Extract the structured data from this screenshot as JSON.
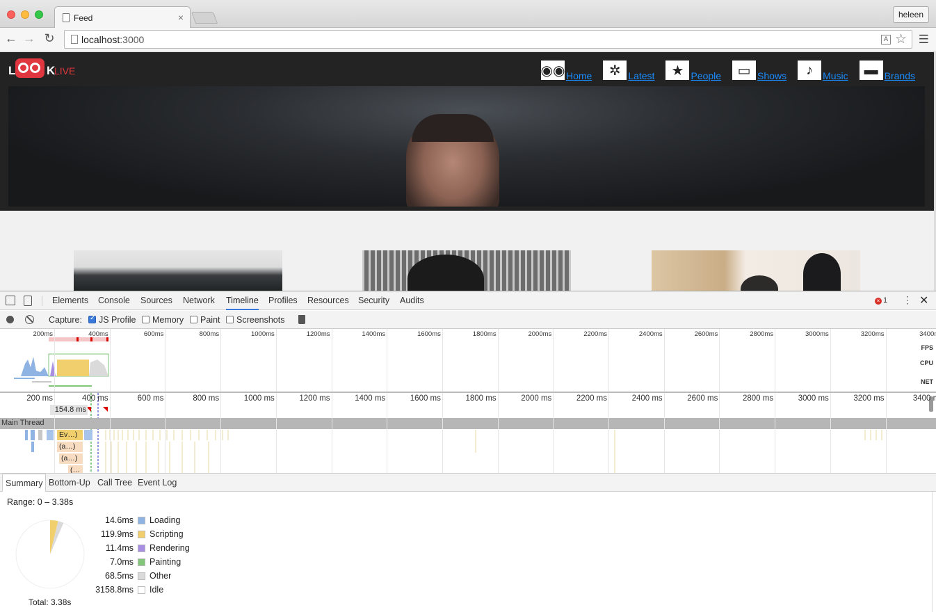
{
  "browser": {
    "tab_title": "Feed",
    "tab_close": "×",
    "user_button": "heleen",
    "url_host": "localhost",
    "url_port": ":3000"
  },
  "site": {
    "logo": {
      "l": "L",
      "k": "K",
      "live": "LIVE"
    },
    "nav": [
      {
        "label": "Home",
        "icon": "owl-icon",
        "glyph": "◉◉"
      },
      {
        "label": "Latest",
        "icon": "film-reel-icon",
        "glyph": "✲"
      },
      {
        "label": "People",
        "icon": "star-icon",
        "glyph": "★"
      },
      {
        "label": "Shows",
        "icon": "monitor-icon",
        "glyph": "▭"
      },
      {
        "label": "Music",
        "icon": "music-note-icon",
        "glyph": "♪"
      },
      {
        "label": "Brands",
        "icon": "shorts-icon",
        "glyph": "▬"
      }
    ],
    "link_color": "#1a8cff",
    "accent_color": "#e0363f"
  },
  "devtools": {
    "tabs": [
      "Elements",
      "Console",
      "Sources",
      "Network",
      "Timeline",
      "Profiles",
      "Resources",
      "Security",
      "Audits"
    ],
    "active_tab": "Timeline",
    "error_count": "1",
    "capture_label": "Capture:",
    "capture_options": [
      {
        "label": "JS Profile",
        "checked": true
      },
      {
        "label": "Memory",
        "checked": false
      },
      {
        "label": "Paint",
        "checked": false
      },
      {
        "label": "Screenshots",
        "checked": false
      }
    ],
    "overview_ticks": [
      "200ms",
      "400ms",
      "600ms",
      "800ms",
      "1000ms",
      "1200ms",
      "1400ms",
      "1600ms",
      "1800ms",
      "2000ms",
      "2200ms",
      "2400ms",
      "2600ms",
      "2800ms",
      "3000ms",
      "3200ms",
      "3400m"
    ],
    "overview_tracks": [
      "FPS",
      "CPU",
      "NET"
    ],
    "flame_ticks": [
      "200 ms",
      "400 ms",
      "600 ms",
      "800 ms",
      "1000 ms",
      "1200 ms",
      "1400 ms",
      "1600 ms",
      "1800 ms",
      "2000 ms",
      "2200 ms",
      "2400 ms",
      "2600 ms",
      "2800 ms",
      "3000 ms",
      "3200 ms",
      "3400 m"
    ],
    "marker_label": "154.8 ms",
    "main_thread_label": "Main Thread",
    "flame_boxes": [
      "Ev…)",
      "(a…)",
      "(a…)",
      "(…"
    ],
    "summary_tabs": [
      "Summary",
      "Bottom-Up",
      "Call Tree",
      "Event Log"
    ],
    "active_summary_tab": "Summary",
    "range": "Range: 0 – 3.38s",
    "total": "Total: 3.38s",
    "legend": [
      {
        "value": "14.6ms",
        "name": "Loading",
        "color": "#8fb3e3"
      },
      {
        "value": "119.9ms",
        "name": "Scripting",
        "color": "#f1cf6c"
      },
      {
        "value": "11.4ms",
        "name": "Rendering",
        "color": "#a88fe3"
      },
      {
        "value": "7.0ms",
        "name": "Painting",
        "color": "#82c57b"
      },
      {
        "value": "68.5ms",
        "name": "Other",
        "color": "#dadada"
      },
      {
        "value": "3158.8ms",
        "name": "Idle",
        "color": "#ffffff"
      }
    ]
  }
}
